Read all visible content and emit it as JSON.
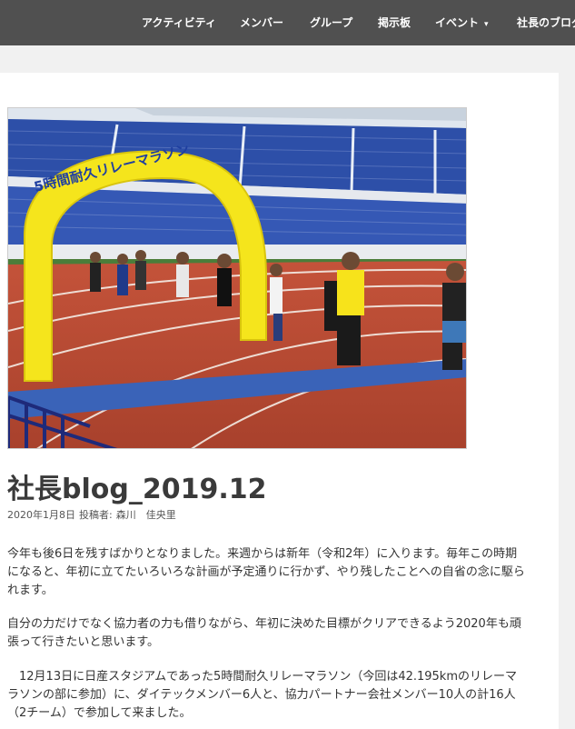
{
  "nav": {
    "items": [
      "アクティビティ",
      "メンバー",
      "グループ",
      "掲示板",
      "イベント",
      "社長のブログ"
    ],
    "event_has_dropdown": true,
    "bar_color": "#505050"
  },
  "post": {
    "title": "社長blog_2019.12",
    "meta": {
      "date": "2020年1月8日",
      "author_prefix": "投稿者:",
      "author": "森川　佳央里"
    },
    "image_banner_text": "5時間耐久リレーマラソン",
    "paragraphs": [
      "今年も後6日を残すばかりとなりました。来週からは新年（令和2年）に入ります。毎年この時期になると、年初に立てたいろいろな計画が予定通りに行かず、やり残したことへの自省の念に駆られます。",
      "自分の力だけでなく協力者の力も借りながら、年初に決めた目標がクリアできるよう2020年も頑張って行きたいと思います。",
      "　12月13日に日産スタジアムであった5時間耐久リレーマラソン（今回は42.195kmのリレーマラソンの部に参加）に、ダイテックメンバー6人と、協力パートナー会社メンバー10人の計16人（2チーム）で参加して来ました。"
    ]
  }
}
